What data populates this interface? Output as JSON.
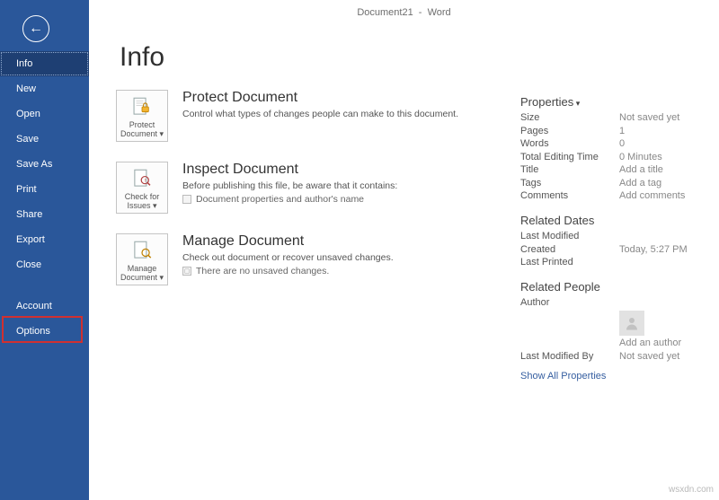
{
  "titlebar": "Document21  -  Word",
  "page_title": "Info",
  "sidebar": {
    "items": [
      {
        "label": "Info",
        "selected": true
      },
      {
        "label": "New"
      },
      {
        "label": "Open"
      },
      {
        "label": "Save"
      },
      {
        "label": "Save As"
      },
      {
        "label": "Print"
      },
      {
        "label": "Share"
      },
      {
        "label": "Export"
      },
      {
        "label": "Close"
      }
    ],
    "bottom_items": [
      {
        "label": "Account"
      },
      {
        "label": "Options",
        "highlighted": true
      }
    ]
  },
  "actions": {
    "protect": {
      "tile_line1": "Protect",
      "tile_line2": "Document ▾",
      "title": "Protect Document",
      "text": "Control what types of changes people can make to this document."
    },
    "inspect": {
      "tile_line1": "Check for",
      "tile_line2": "Issues ▾",
      "title": "Inspect Document",
      "text": "Before publishing this file, be aware that it contains:",
      "sub": "Document properties and author's name"
    },
    "manage": {
      "tile_line1": "Manage",
      "tile_line2": "Document ▾",
      "title": "Manage Document",
      "text": "Check out document or recover unsaved changes.",
      "sub": "There are no unsaved changes."
    }
  },
  "properties": {
    "header": "Properties",
    "rows": [
      {
        "k": "Size",
        "v": "Not saved yet"
      },
      {
        "k": "Pages",
        "v": "1"
      },
      {
        "k": "Words",
        "v": "0"
      },
      {
        "k": "Total Editing Time",
        "v": "0 Minutes"
      },
      {
        "k": "Title",
        "v": "Add a title"
      },
      {
        "k": "Tags",
        "v": "Add a tag"
      },
      {
        "k": "Comments",
        "v": "Add comments"
      }
    ],
    "dates_header": "Related Dates",
    "dates": [
      {
        "k": "Last Modified",
        "v": ""
      },
      {
        "k": "Created",
        "v": "Today, 5:27 PM"
      },
      {
        "k": "Last Printed",
        "v": ""
      }
    ],
    "people_header": "Related People",
    "author_label": "Author",
    "add_author": "Add an author",
    "last_mod_by_k": "Last Modified By",
    "last_mod_by_v": "Not saved yet",
    "show_all": "Show All Properties"
  },
  "watermark": "wsxdn.com"
}
